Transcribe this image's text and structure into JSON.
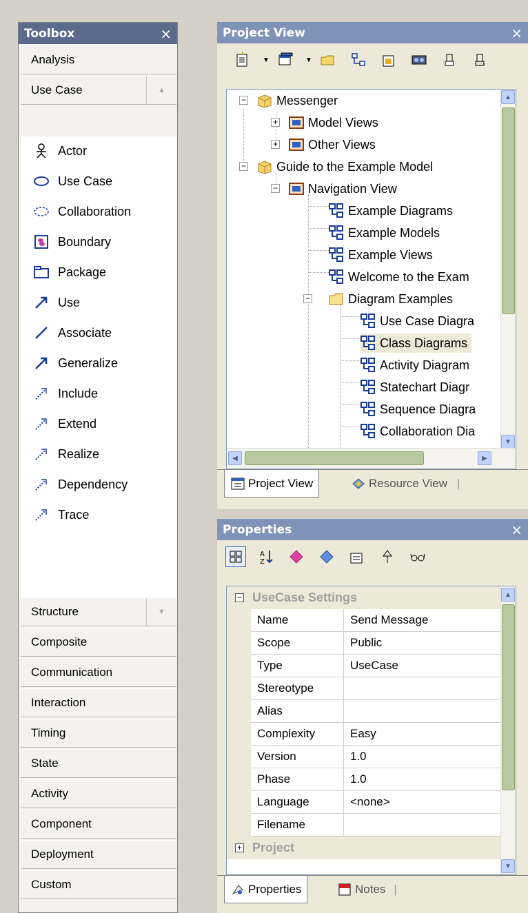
{
  "toolbox": {
    "title": "Toolbox",
    "close": "×",
    "top_categories": [
      "Analysis",
      "Use Case"
    ],
    "items": [
      {
        "label": "Actor",
        "icon": "actor-icon"
      },
      {
        "label": "Use Case",
        "icon": "use-case-icon"
      },
      {
        "label": "Collaboration",
        "icon": "collaboration-icon"
      },
      {
        "label": "Boundary",
        "icon": "boundary-icon"
      },
      {
        "label": "Package",
        "icon": "package-icon"
      },
      {
        "label": "Use",
        "icon": "use-arrow-icon"
      },
      {
        "label": "Associate",
        "icon": "associate-line-icon"
      },
      {
        "label": "Generalize",
        "icon": "generalize-arrow-icon"
      },
      {
        "label": "Include",
        "icon": "include-dashed-arrow-icon"
      },
      {
        "label": "Extend",
        "icon": "extend-dashed-arrow-icon"
      },
      {
        "label": "Realize",
        "icon": "realize-dashed-arrow-icon"
      },
      {
        "label": "Dependency",
        "icon": "dependency-dashed-arrow-icon"
      },
      {
        "label": "Trace",
        "icon": "trace-dashed-arrow-icon"
      }
    ],
    "bottom_categories": [
      "Structure",
      "Composite",
      "Communication",
      "Interaction",
      "Timing",
      "State",
      "Activity",
      "Component",
      "Deployment",
      "Custom"
    ]
  },
  "project_view": {
    "title": "Project View",
    "close": "×",
    "tree": [
      {
        "label": "Messenger",
        "icon": "package-folder-icon"
      },
      {
        "label": "Model Views",
        "icon": "view-icon"
      },
      {
        "label": "Other Views",
        "icon": "view-icon"
      },
      {
        "label": "Guide to the Example Model",
        "icon": "package-folder-icon"
      },
      {
        "label": "Navigation View",
        "icon": "view-icon"
      },
      {
        "label": "Example Diagrams",
        "icon": "diagram-icon"
      },
      {
        "label": "Example Models",
        "icon": "diagram-icon"
      },
      {
        "label": "Example Views",
        "icon": "diagram-icon"
      },
      {
        "label": "Welcome to the Exam",
        "icon": "diagram-icon"
      },
      {
        "label": "Diagram Examples",
        "icon": "folder-icon"
      },
      {
        "label": "Use Case Diagra",
        "icon": "diagram-icon"
      },
      {
        "label": "Class Diagrams",
        "icon": "diagram-icon"
      },
      {
        "label": "Activity Diagram",
        "icon": "diagram-icon"
      },
      {
        "label": "Statechart Diagr",
        "icon": "diagram-icon"
      },
      {
        "label": "Sequence Diagra",
        "icon": "diagram-icon"
      },
      {
        "label": "Collaboration Dia",
        "icon": "diagram-icon"
      }
    ],
    "tabs": [
      "Project View",
      "Resource View"
    ]
  },
  "properties": {
    "title": "Properties",
    "close": "×",
    "group": "UseCase Settings",
    "rows": [
      {
        "name": "Name",
        "value": "Send Message"
      },
      {
        "name": "Scope",
        "value": "Public"
      },
      {
        "name": "Type",
        "value": "UseCase"
      },
      {
        "name": "Stereotype",
        "value": ""
      },
      {
        "name": "Alias",
        "value": ""
      },
      {
        "name": "Complexity",
        "value": "Easy"
      },
      {
        "name": "Version",
        "value": "1.0"
      },
      {
        "name": "Phase",
        "value": "1.0"
      },
      {
        "name": "Language",
        "value": "<none>"
      },
      {
        "name": "Filename",
        "value": ""
      }
    ],
    "group2": "Project",
    "tabs": [
      "Properties",
      "Notes"
    ]
  },
  "colors": {
    "toolbox_title": "#5a6b8c",
    "panel_title": "#7f93b8",
    "panel_bg": "#ece9d8",
    "selected_row": "#ece9d8"
  }
}
